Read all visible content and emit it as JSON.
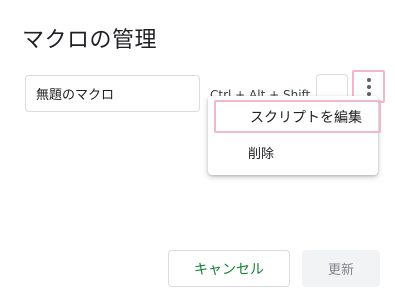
{
  "dialog": {
    "title": "マクロの管理"
  },
  "macro": {
    "name": "無題のマクロ",
    "shortcut_prefix": "Ctrl + Alt + Shift +",
    "shortcut_key": ""
  },
  "menu": {
    "items": [
      {
        "label": "スクリプトを編集"
      },
      {
        "label": "削除"
      }
    ]
  },
  "footer": {
    "cancel_label": "キャンセル",
    "update_label": "更新"
  },
  "colors": {
    "highlight_outline": "#f0b8c8",
    "cancel_text": "#188038",
    "disabled_text": "#80868b"
  },
  "icons": {
    "more": "more-vert-icon"
  }
}
